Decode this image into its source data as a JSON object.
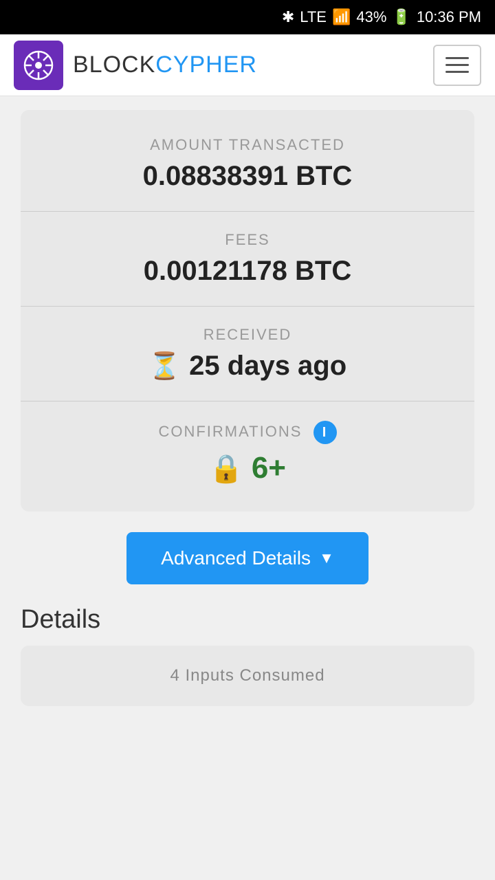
{
  "statusBar": {
    "bluetooth": "⚡",
    "lte": "LTE",
    "signal": "▋▋▋",
    "battery": "43%",
    "time": "10:36 PM"
  },
  "header": {
    "logoBlockText": "BLOCK",
    "logoCypherText": "CYPHER",
    "menuLabel": "menu"
  },
  "transaction": {
    "amountLabel": "AMOUNT TRANSACTED",
    "amountValue": "0.08838391 BTC",
    "feesLabel": "FEES",
    "feesValue": "0.00121178 BTC",
    "receivedLabel": "RECEIVED",
    "receivedValue": "25 days ago",
    "confirmationsLabel": "CONFIRMATIONS",
    "confirmationsValue": "6+"
  },
  "advancedButton": {
    "label": "Advanced Details"
  },
  "detailsSection": {
    "title": "Details",
    "card": {
      "label": "4 Inputs Consumed"
    }
  }
}
